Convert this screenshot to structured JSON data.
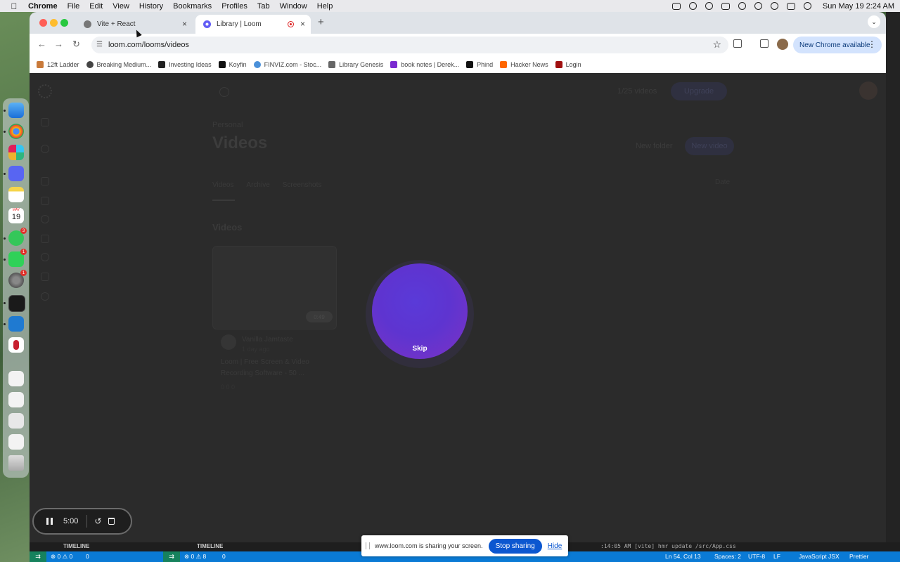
{
  "menubar": {
    "app": "Chrome",
    "items": [
      "File",
      "Edit",
      "View",
      "History",
      "Bookmarks",
      "Profiles",
      "Tab",
      "Window",
      "Help"
    ],
    "clock": "Sun May 19  2:24 AM"
  },
  "dock": {
    "calendar_month": "MAY",
    "calendar_day": "19",
    "badges": [
      "3",
      "1",
      "1"
    ]
  },
  "browser": {
    "tabs": [
      {
        "title": "Vite + React"
      },
      {
        "title": "Library | Loom"
      }
    ],
    "url": "loom.com/looms/videos",
    "new_chrome_label": "New Chrome available",
    "bookmarks": [
      "12ft Ladder",
      "Breaking Medium...",
      "Investing Ideas",
      "Koyfin",
      "FINVIZ.com - Stoc...",
      "Library Genesis",
      "book notes | Derek...",
      "Phind",
      "Hacker News",
      "Login"
    ]
  },
  "loom": {
    "usage": "1/25 videos",
    "upgrade_label": "Upgrade",
    "breadcrumb": "Personal",
    "title": "Videos",
    "new_folder_label": "New folder",
    "new_video_label": "New video",
    "tabs": [
      "Videos",
      "Archive",
      "Screenshots"
    ],
    "sort_label": "Date",
    "section_heading": "Videos",
    "card": {
      "duration": "0:49",
      "author": "Vanilla Jamtaste",
      "author_sub": "1 day ago",
      "title": "Loom | Free Screen & Video Recording Software - 50 ...",
      "stats": "0   0   0"
    },
    "skip_label": "Skip"
  },
  "recorder": {
    "time": "5:00"
  },
  "vscode": {
    "timeline_left": "TIMELINE",
    "timeline_right": "TIMELINE",
    "terminal_line": ":14:05 AM [vite] hmr update /src/App.css",
    "status_left_a": "⊗ 0 ⚠ 0",
    "status_left_b": "⊗ 0 ⚠ 8",
    "status_ports_a": "0",
    "status_ports_b": "0",
    "position": "Ln 54, Col 13",
    "spaces": "Spaces: 2",
    "encoding": "UTF-8",
    "eol": "LF",
    "language": "JavaScript JSX",
    "formatter": "Prettier"
  },
  "share_banner": {
    "message": "www.loom.com is sharing your screen.",
    "stop_label": "Stop sharing",
    "hide_label": "Hide"
  },
  "colors": {
    "bubble_from": "#5a3ad8",
    "bubble_to": "#7d32c4",
    "stop_button": "#0b57d0",
    "vscode_status": "#0a7ad5"
  }
}
